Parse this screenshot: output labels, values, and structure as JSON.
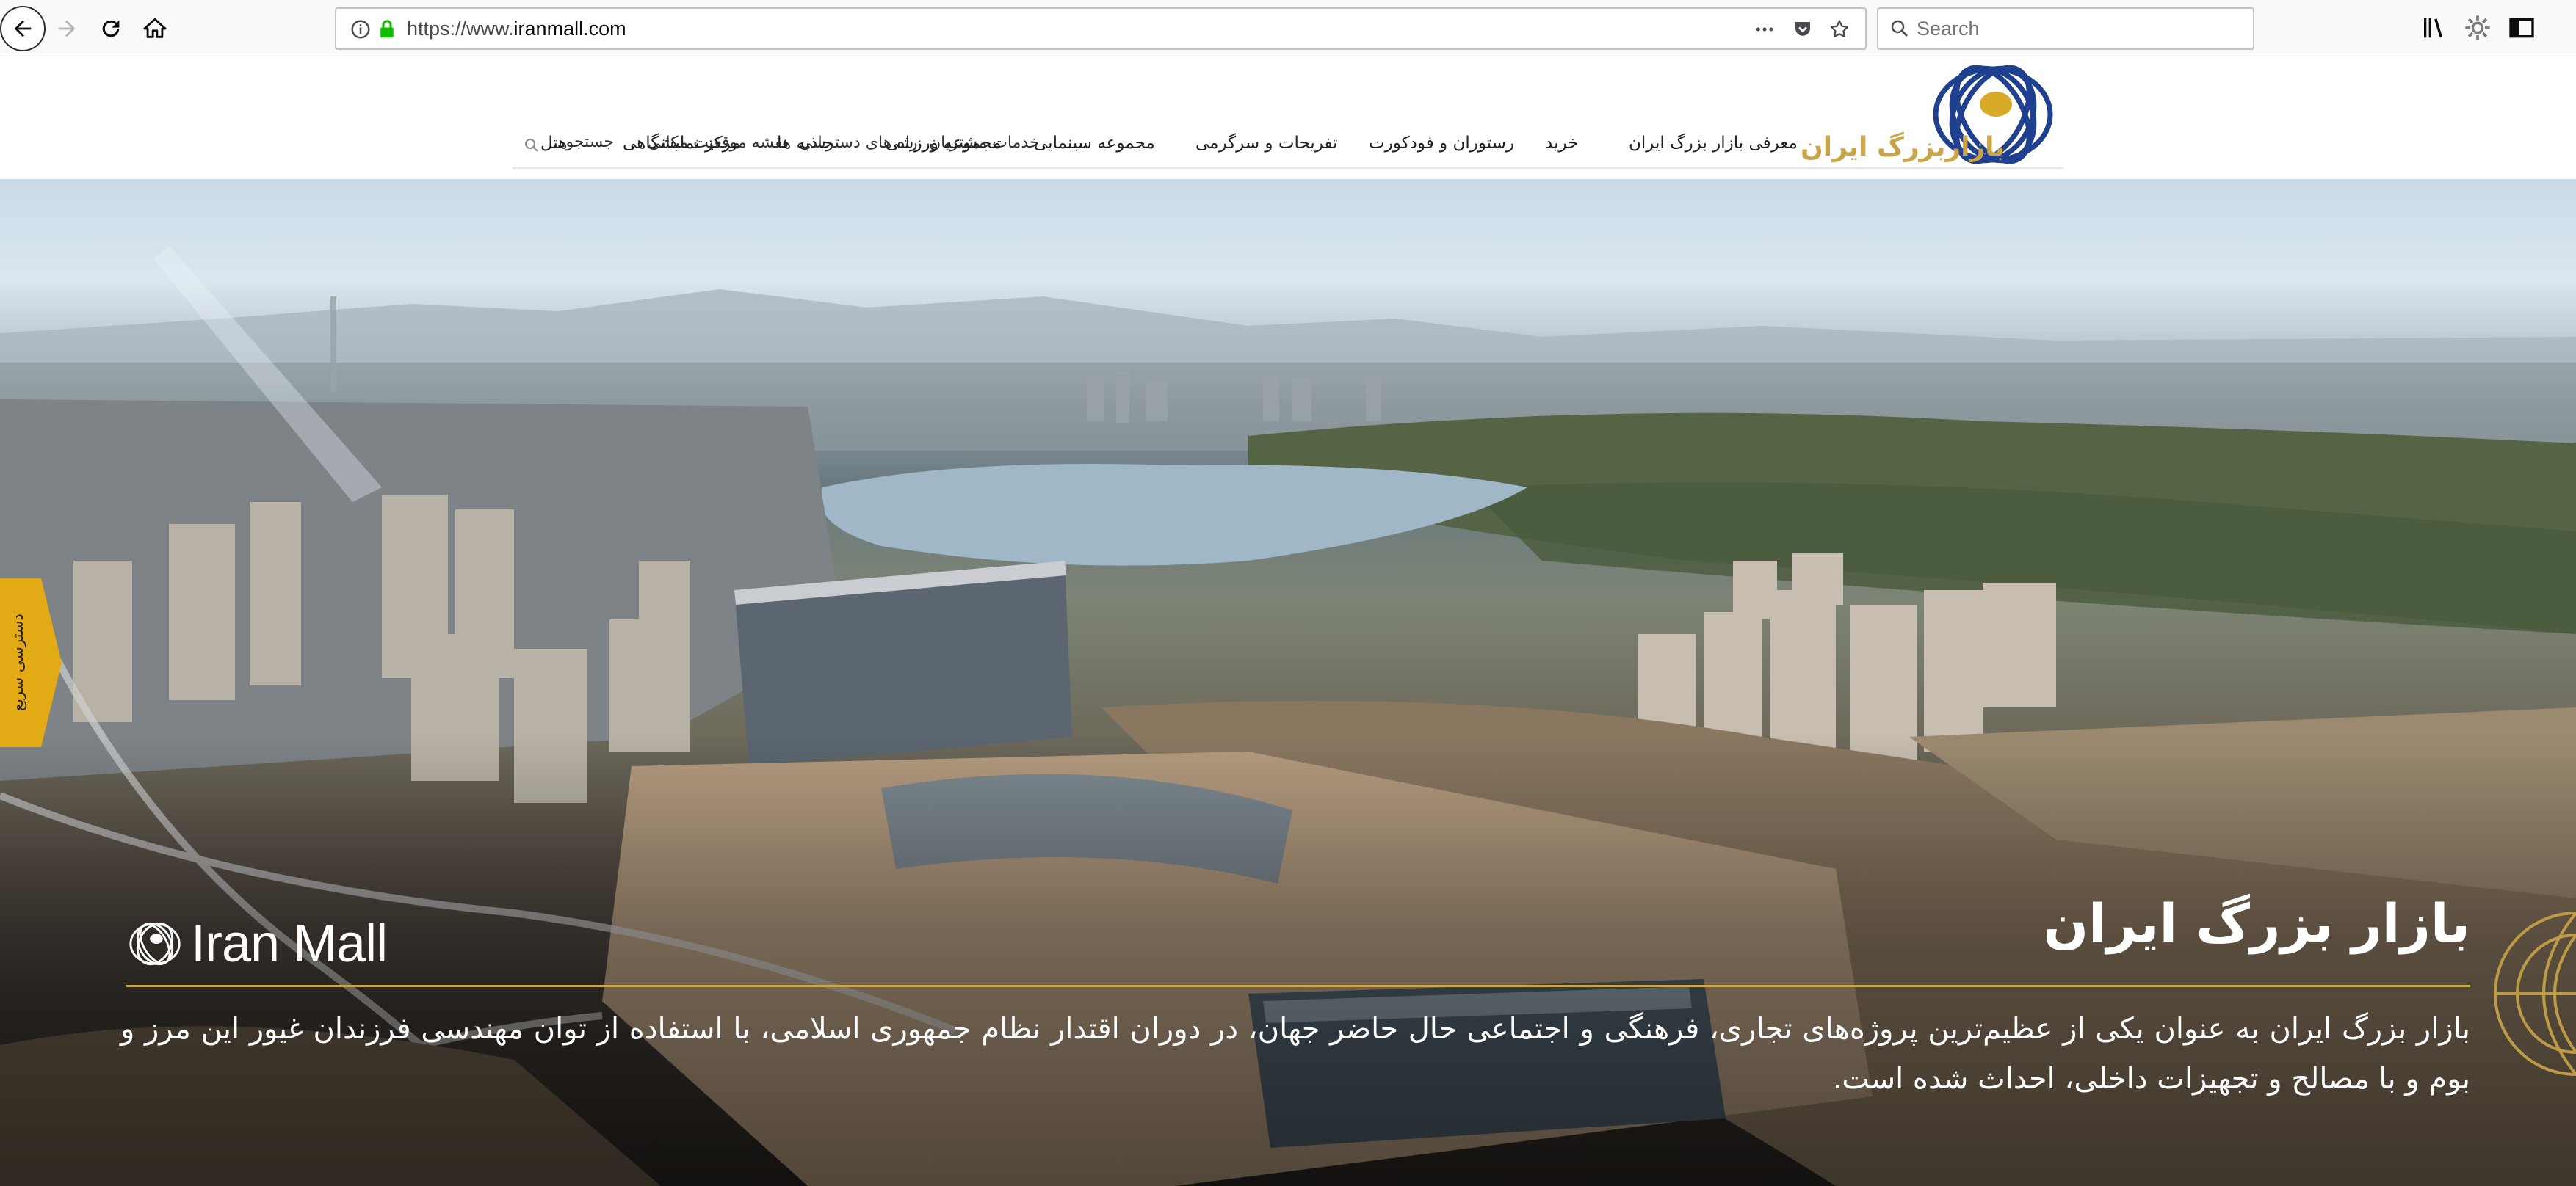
{
  "browser": {
    "url_scheme": "https://www.",
    "url_host": "iranmall.com",
    "search_placeholder": "Search"
  },
  "site": {
    "logo_text": "بازاربزرگ ایران",
    "top_links": [
      "خدمات مشتریان",
      "راه های دسترسی",
      "نقشه موقعیت مکانی"
    ],
    "search_placeholder": "جستجو...",
    "main_nav": [
      "معرفی بازار بزرگ ایران",
      "خرید",
      "رستوران و فودکورت",
      "تفریحات و سرگرمی",
      "مجموعه سینمایی",
      "مجموعه ورزشی",
      "جاذبه ها",
      "مرکز نمایشگاهی",
      "هتل"
    ]
  },
  "hero": {
    "quick_access": "دسترسی سریع",
    "brand_wordmark": "Iran Mall",
    "title": "بازار بزرگ ایران",
    "description": "بازار بزرگ ایران به عنوان یکی از عظیم‌ترین پروژه‌های تجاری، فرهنگی و اجتماعی حال حاضر جهان، در دوران اقتدار نظام جمهوری اسلامی، با استفاده از توان مهندسی فرزندان غیور این مرز و بوم و با مصالح و تجهیزات داخلی، احداث شده است."
  },
  "colors": {
    "gold": "#c9a448",
    "logo_blue": "#1f3f8f",
    "quick_access_bg": "#e2aa14"
  }
}
